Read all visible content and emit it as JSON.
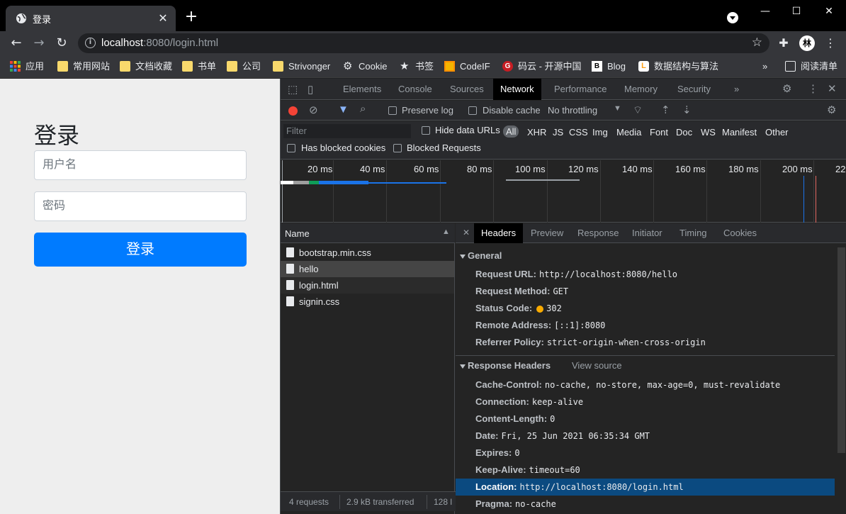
{
  "browser": {
    "tab_title": "登录",
    "new_tab": "+",
    "close_tab": "✕",
    "url_host": "localhost",
    "url_path": ":8080/login.html",
    "bookmarks": [
      {
        "label": "应用",
        "icon": "apps-grid-icon"
      },
      {
        "label": "常用网站",
        "icon": "folder-icon"
      },
      {
        "label": "文档收藏",
        "icon": "folder-icon"
      },
      {
        "label": "书单",
        "icon": "folder-icon"
      },
      {
        "label": "公司",
        "icon": "folder-icon"
      },
      {
        "label": "Strivonger",
        "icon": "folder-icon"
      },
      {
        "label": "Cookie",
        "icon": "gear-icon"
      },
      {
        "label": "书签",
        "icon": "star-icon"
      },
      {
        "label": "CodeIF",
        "icon": "codeif-icon"
      },
      {
        "label": "码云 - 开源中国",
        "icon": "gitee-icon"
      },
      {
        "label": "Blog",
        "icon": "blog-icon"
      },
      {
        "label": "数据结构与算法",
        "icon": "leetcode-icon"
      }
    ],
    "more_bookmarks": "»",
    "reading_list": "阅读清单"
  },
  "page": {
    "title": "登录",
    "username_placeholder": "用户名",
    "password_placeholder": "密码",
    "login_button": "登录"
  },
  "devtools": {
    "tabs": [
      "Elements",
      "Console",
      "Sources",
      "Network",
      "Performance",
      "Memory",
      "Security"
    ],
    "active_tab": "Network",
    "more_tabs": "»",
    "toolbar": {
      "preserve_log": "Preserve log",
      "disable_cache": "Disable cache",
      "throttling": "No throttling"
    },
    "filter": {
      "placeholder": "Filter",
      "hide_data_urls": "Hide data URLs",
      "types": [
        "All",
        "XHR",
        "JS",
        "CSS",
        "Img",
        "Media",
        "Font",
        "Doc",
        "WS",
        "Manifest",
        "Other"
      ],
      "has_blocked_cookies": "Has blocked cookies",
      "blocked_requests": "Blocked Requests"
    },
    "timeline_ticks": [
      "20 ms",
      "40 ms",
      "60 ms",
      "80 ms",
      "100 ms",
      "120 ms",
      "140 ms",
      "160 ms",
      "180 ms",
      "200 ms",
      "22"
    ],
    "name_header": "Name",
    "requests": [
      "bootstrap.min.css",
      "hello",
      "login.html",
      "signin.css"
    ],
    "selected_request": "hello",
    "footer": {
      "requests": "4 requests",
      "transferred": "2.9 kB transferred",
      "resources": "128 l"
    },
    "detail_tabs": [
      "Headers",
      "Preview",
      "Response",
      "Initiator",
      "Timing",
      "Cookies"
    ],
    "active_detail_tab": "Headers",
    "general": {
      "title": "General",
      "rows": [
        {
          "k": "Request URL:",
          "v": "http://localhost:8080/hello"
        },
        {
          "k": "Request Method:",
          "v": "GET"
        },
        {
          "k": "Status Code:",
          "v": "302"
        },
        {
          "k": "Remote Address:",
          "v": "[::1]:8080"
        },
        {
          "k": "Referrer Policy:",
          "v": "strict-origin-when-cross-origin"
        }
      ]
    },
    "response_headers": {
      "title": "Response Headers",
      "view_source": "View source",
      "rows": [
        {
          "k": "Cache-Control:",
          "v": "no-cache, no-store, max-age=0, must-revalidate"
        },
        {
          "k": "Connection:",
          "v": "keep-alive"
        },
        {
          "k": "Content-Length:",
          "v": "0"
        },
        {
          "k": "Date:",
          "v": "Fri, 25 Jun 2021 06:35:34 GMT"
        },
        {
          "k": "Expires:",
          "v": "0"
        },
        {
          "k": "Keep-Alive:",
          "v": "timeout=60"
        },
        {
          "k": "Location:",
          "v": "http://localhost:8080/login.html"
        },
        {
          "k": "Pragma:",
          "v": "no-cache"
        }
      ]
    },
    "colors": {
      "status_dot": "#f9ab00",
      "selected_row": "#0b4a80",
      "record": "#f44336",
      "primary_button": "#007bff"
    }
  }
}
